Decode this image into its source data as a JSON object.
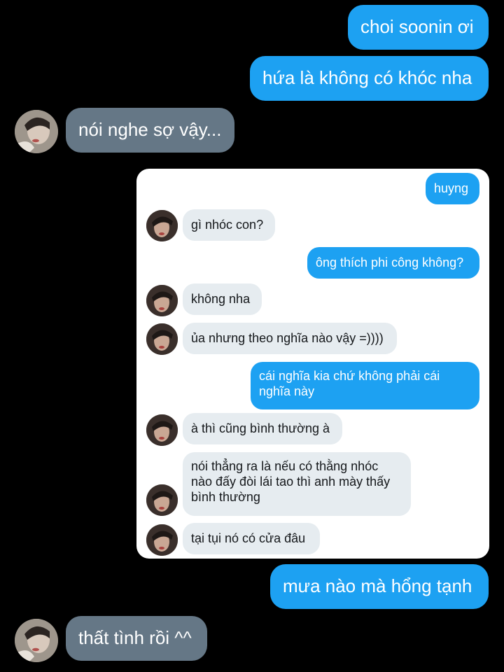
{
  "conversation": {
    "msg1": "choi soonin ơi",
    "msg2": "hứa là không có khóc nha",
    "msg3": "nói nghe sợ vậy...",
    "msg4": "mưa nào mà hổng tạnh",
    "msg5": "thất tình rồi ^^"
  },
  "embedded_chat": {
    "m1": "huyng",
    "m2": "gì nhóc con?",
    "m3": "ông thích phi công không?",
    "m4": "không nha",
    "m5": "ủa nhưng theo nghĩa nào vậy =))))",
    "m6": "cái nghĩa kia chứ không phải cái nghĩa này",
    "m7": "à thì cũng bình thường à",
    "m8": "nói thẳng ra là nếu có thằng nhóc nào đấy đòi lái tao thì anh mày thấy bình thường",
    "m9": "tại tụi nó có cửa đâu"
  },
  "colors": {
    "background": "#000000",
    "outgoing_bubble": "#1da1f2",
    "incoming_bubble": "#657786",
    "embedded_incoming_bubble": "#e6ecf0",
    "embedded_background": "#ffffff"
  },
  "icons": {
    "avatar": "profile-photo-avatar"
  }
}
